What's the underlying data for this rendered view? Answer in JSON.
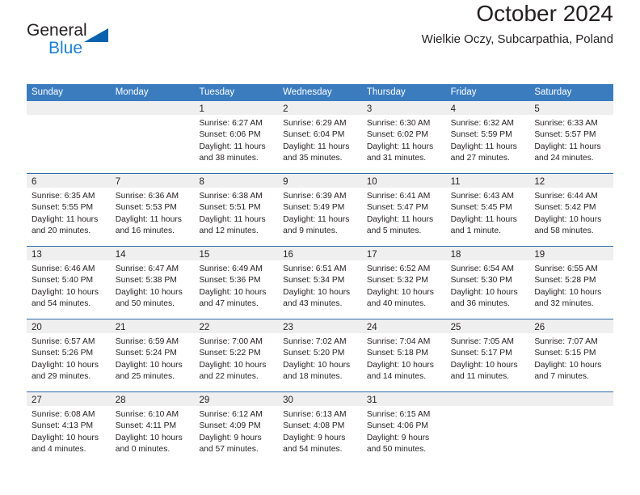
{
  "logo": {
    "word_one": "General",
    "word_two": "Blue",
    "triangle_icon": "blue-triangle-icon",
    "colors": {
      "general": "#231f20",
      "blue": "#1b7fd4",
      "triangle": "#0a62ae"
    }
  },
  "header": {
    "title": "October 2024",
    "subtitle": "Wielkie Oczy, Subcarpathia, Poland"
  },
  "theme": {
    "header_blue": "#3b7cbf",
    "row_divider_blue": "#2f6ca8",
    "day_band_gray": "#efefef",
    "cell_white": "#ffffff",
    "text": "#231f20"
  },
  "weekdays": [
    "Sunday",
    "Monday",
    "Tuesday",
    "Wednesday",
    "Thursday",
    "Friday",
    "Saturday"
  ],
  "weeks": [
    [
      {
        "day": "",
        "lines": []
      },
      {
        "day": "",
        "lines": []
      },
      {
        "day": "1",
        "lines": [
          "Sunrise: 6:27 AM",
          "Sunset: 6:06 PM",
          "Daylight: 11 hours",
          "and 38 minutes."
        ]
      },
      {
        "day": "2",
        "lines": [
          "Sunrise: 6:29 AM",
          "Sunset: 6:04 PM",
          "Daylight: 11 hours",
          "and 35 minutes."
        ]
      },
      {
        "day": "3",
        "lines": [
          "Sunrise: 6:30 AM",
          "Sunset: 6:02 PM",
          "Daylight: 11 hours",
          "and 31 minutes."
        ]
      },
      {
        "day": "4",
        "lines": [
          "Sunrise: 6:32 AM",
          "Sunset: 5:59 PM",
          "Daylight: 11 hours",
          "and 27 minutes."
        ]
      },
      {
        "day": "5",
        "lines": [
          "Sunrise: 6:33 AM",
          "Sunset: 5:57 PM",
          "Daylight: 11 hours",
          "and 24 minutes."
        ]
      }
    ],
    [
      {
        "day": "6",
        "lines": [
          "Sunrise: 6:35 AM",
          "Sunset: 5:55 PM",
          "Daylight: 11 hours",
          "and 20 minutes."
        ]
      },
      {
        "day": "7",
        "lines": [
          "Sunrise: 6:36 AM",
          "Sunset: 5:53 PM",
          "Daylight: 11 hours",
          "and 16 minutes."
        ]
      },
      {
        "day": "8",
        "lines": [
          "Sunrise: 6:38 AM",
          "Sunset: 5:51 PM",
          "Daylight: 11 hours",
          "and 12 minutes."
        ]
      },
      {
        "day": "9",
        "lines": [
          "Sunrise: 6:39 AM",
          "Sunset: 5:49 PM",
          "Daylight: 11 hours",
          "and 9 minutes."
        ]
      },
      {
        "day": "10",
        "lines": [
          "Sunrise: 6:41 AM",
          "Sunset: 5:47 PM",
          "Daylight: 11 hours",
          "and 5 minutes."
        ]
      },
      {
        "day": "11",
        "lines": [
          "Sunrise: 6:43 AM",
          "Sunset: 5:45 PM",
          "Daylight: 11 hours",
          "and 1 minute."
        ]
      },
      {
        "day": "12",
        "lines": [
          "Sunrise: 6:44 AM",
          "Sunset: 5:42 PM",
          "Daylight: 10 hours",
          "and 58 minutes."
        ]
      }
    ],
    [
      {
        "day": "13",
        "lines": [
          "Sunrise: 6:46 AM",
          "Sunset: 5:40 PM",
          "Daylight: 10 hours",
          "and 54 minutes."
        ]
      },
      {
        "day": "14",
        "lines": [
          "Sunrise: 6:47 AM",
          "Sunset: 5:38 PM",
          "Daylight: 10 hours",
          "and 50 minutes."
        ]
      },
      {
        "day": "15",
        "lines": [
          "Sunrise: 6:49 AM",
          "Sunset: 5:36 PM",
          "Daylight: 10 hours",
          "and 47 minutes."
        ]
      },
      {
        "day": "16",
        "lines": [
          "Sunrise: 6:51 AM",
          "Sunset: 5:34 PM",
          "Daylight: 10 hours",
          "and 43 minutes."
        ]
      },
      {
        "day": "17",
        "lines": [
          "Sunrise: 6:52 AM",
          "Sunset: 5:32 PM",
          "Daylight: 10 hours",
          "and 40 minutes."
        ]
      },
      {
        "day": "18",
        "lines": [
          "Sunrise: 6:54 AM",
          "Sunset: 5:30 PM",
          "Daylight: 10 hours",
          "and 36 minutes."
        ]
      },
      {
        "day": "19",
        "lines": [
          "Sunrise: 6:55 AM",
          "Sunset: 5:28 PM",
          "Daylight: 10 hours",
          "and 32 minutes."
        ]
      }
    ],
    [
      {
        "day": "20",
        "lines": [
          "Sunrise: 6:57 AM",
          "Sunset: 5:26 PM",
          "Daylight: 10 hours",
          "and 29 minutes."
        ]
      },
      {
        "day": "21",
        "lines": [
          "Sunrise: 6:59 AM",
          "Sunset: 5:24 PM",
          "Daylight: 10 hours",
          "and 25 minutes."
        ]
      },
      {
        "day": "22",
        "lines": [
          "Sunrise: 7:00 AM",
          "Sunset: 5:22 PM",
          "Daylight: 10 hours",
          "and 22 minutes."
        ]
      },
      {
        "day": "23",
        "lines": [
          "Sunrise: 7:02 AM",
          "Sunset: 5:20 PM",
          "Daylight: 10 hours",
          "and 18 minutes."
        ]
      },
      {
        "day": "24",
        "lines": [
          "Sunrise: 7:04 AM",
          "Sunset: 5:18 PM",
          "Daylight: 10 hours",
          "and 14 minutes."
        ]
      },
      {
        "day": "25",
        "lines": [
          "Sunrise: 7:05 AM",
          "Sunset: 5:17 PM",
          "Daylight: 10 hours",
          "and 11 minutes."
        ]
      },
      {
        "day": "26",
        "lines": [
          "Sunrise: 7:07 AM",
          "Sunset: 5:15 PM",
          "Daylight: 10 hours",
          "and 7 minutes."
        ]
      }
    ],
    [
      {
        "day": "27",
        "lines": [
          "Sunrise: 6:08 AM",
          "Sunset: 4:13 PM",
          "Daylight: 10 hours",
          "and 4 minutes."
        ]
      },
      {
        "day": "28",
        "lines": [
          "Sunrise: 6:10 AM",
          "Sunset: 4:11 PM",
          "Daylight: 10 hours",
          "and 0 minutes."
        ]
      },
      {
        "day": "29",
        "lines": [
          "Sunrise: 6:12 AM",
          "Sunset: 4:09 PM",
          "Daylight: 9 hours",
          "and 57 minutes."
        ]
      },
      {
        "day": "30",
        "lines": [
          "Sunrise: 6:13 AM",
          "Sunset: 4:08 PM",
          "Daylight: 9 hours",
          "and 54 minutes."
        ]
      },
      {
        "day": "31",
        "lines": [
          "Sunrise: 6:15 AM",
          "Sunset: 4:06 PM",
          "Daylight: 9 hours",
          "and 50 minutes."
        ]
      },
      {
        "day": "",
        "lines": []
      },
      {
        "day": "",
        "lines": []
      }
    ]
  ]
}
